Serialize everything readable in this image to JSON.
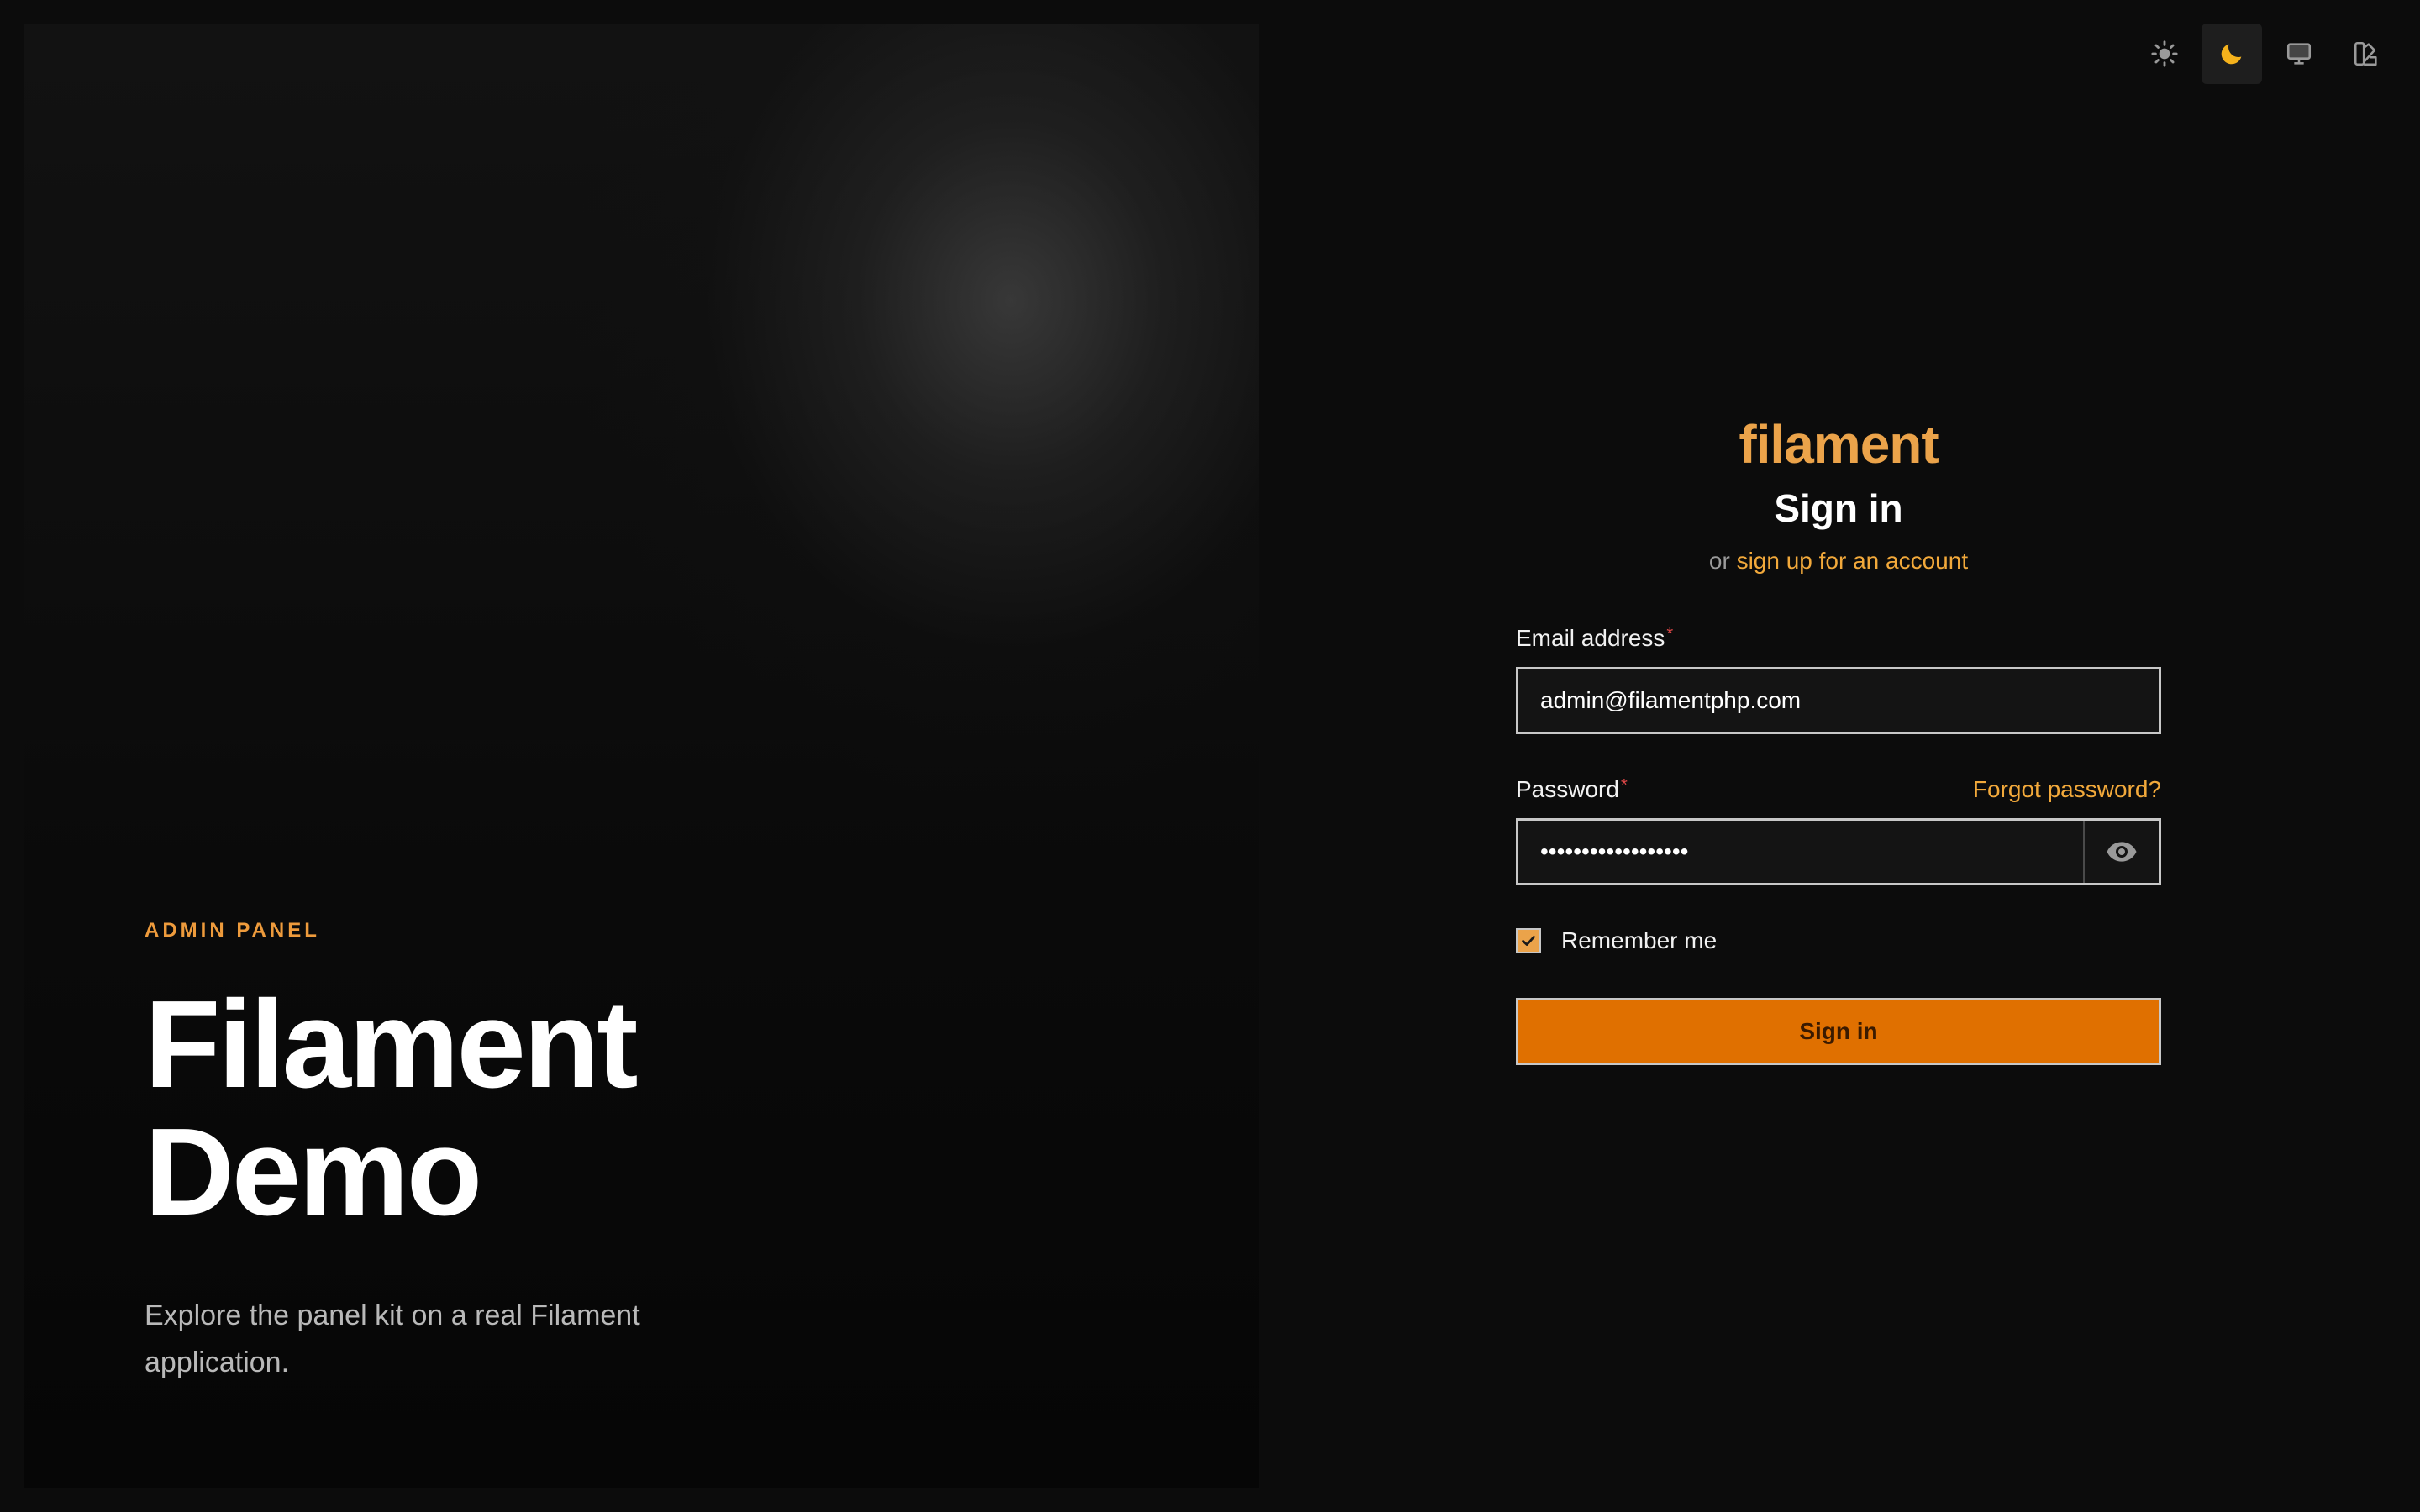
{
  "hero": {
    "eyebrow": "ADMIN PANEL",
    "title": "Filament Demo",
    "description": "Explore the panel kit on a real Filament application."
  },
  "theme_switcher": {
    "options": [
      {
        "name": "light",
        "icon": "sun-icon",
        "active": false
      },
      {
        "name": "dark",
        "icon": "moon-icon",
        "active": true
      },
      {
        "name": "system",
        "icon": "monitor-icon",
        "active": false
      },
      {
        "name": "custom",
        "icon": "swatch-icon",
        "active": false
      }
    ],
    "active_color": "#f5b21c"
  },
  "auth": {
    "logo": "filament",
    "heading": "Sign in",
    "subheading_prefix": "or",
    "signup_link": "sign up for an account",
    "email": {
      "label": "Email address",
      "required_mark": "*",
      "value": "admin@filamentphp.com"
    },
    "password": {
      "label": "Password",
      "required_mark": "*",
      "value": "••••••••••••••••••",
      "forgot_link": "Forgot password?"
    },
    "remember": {
      "label": "Remember me",
      "checked": true
    },
    "submit_label": "Sign in"
  },
  "colors": {
    "accent": "#eba34a",
    "primary_button": "#e07000",
    "link": "#f2a93b"
  }
}
